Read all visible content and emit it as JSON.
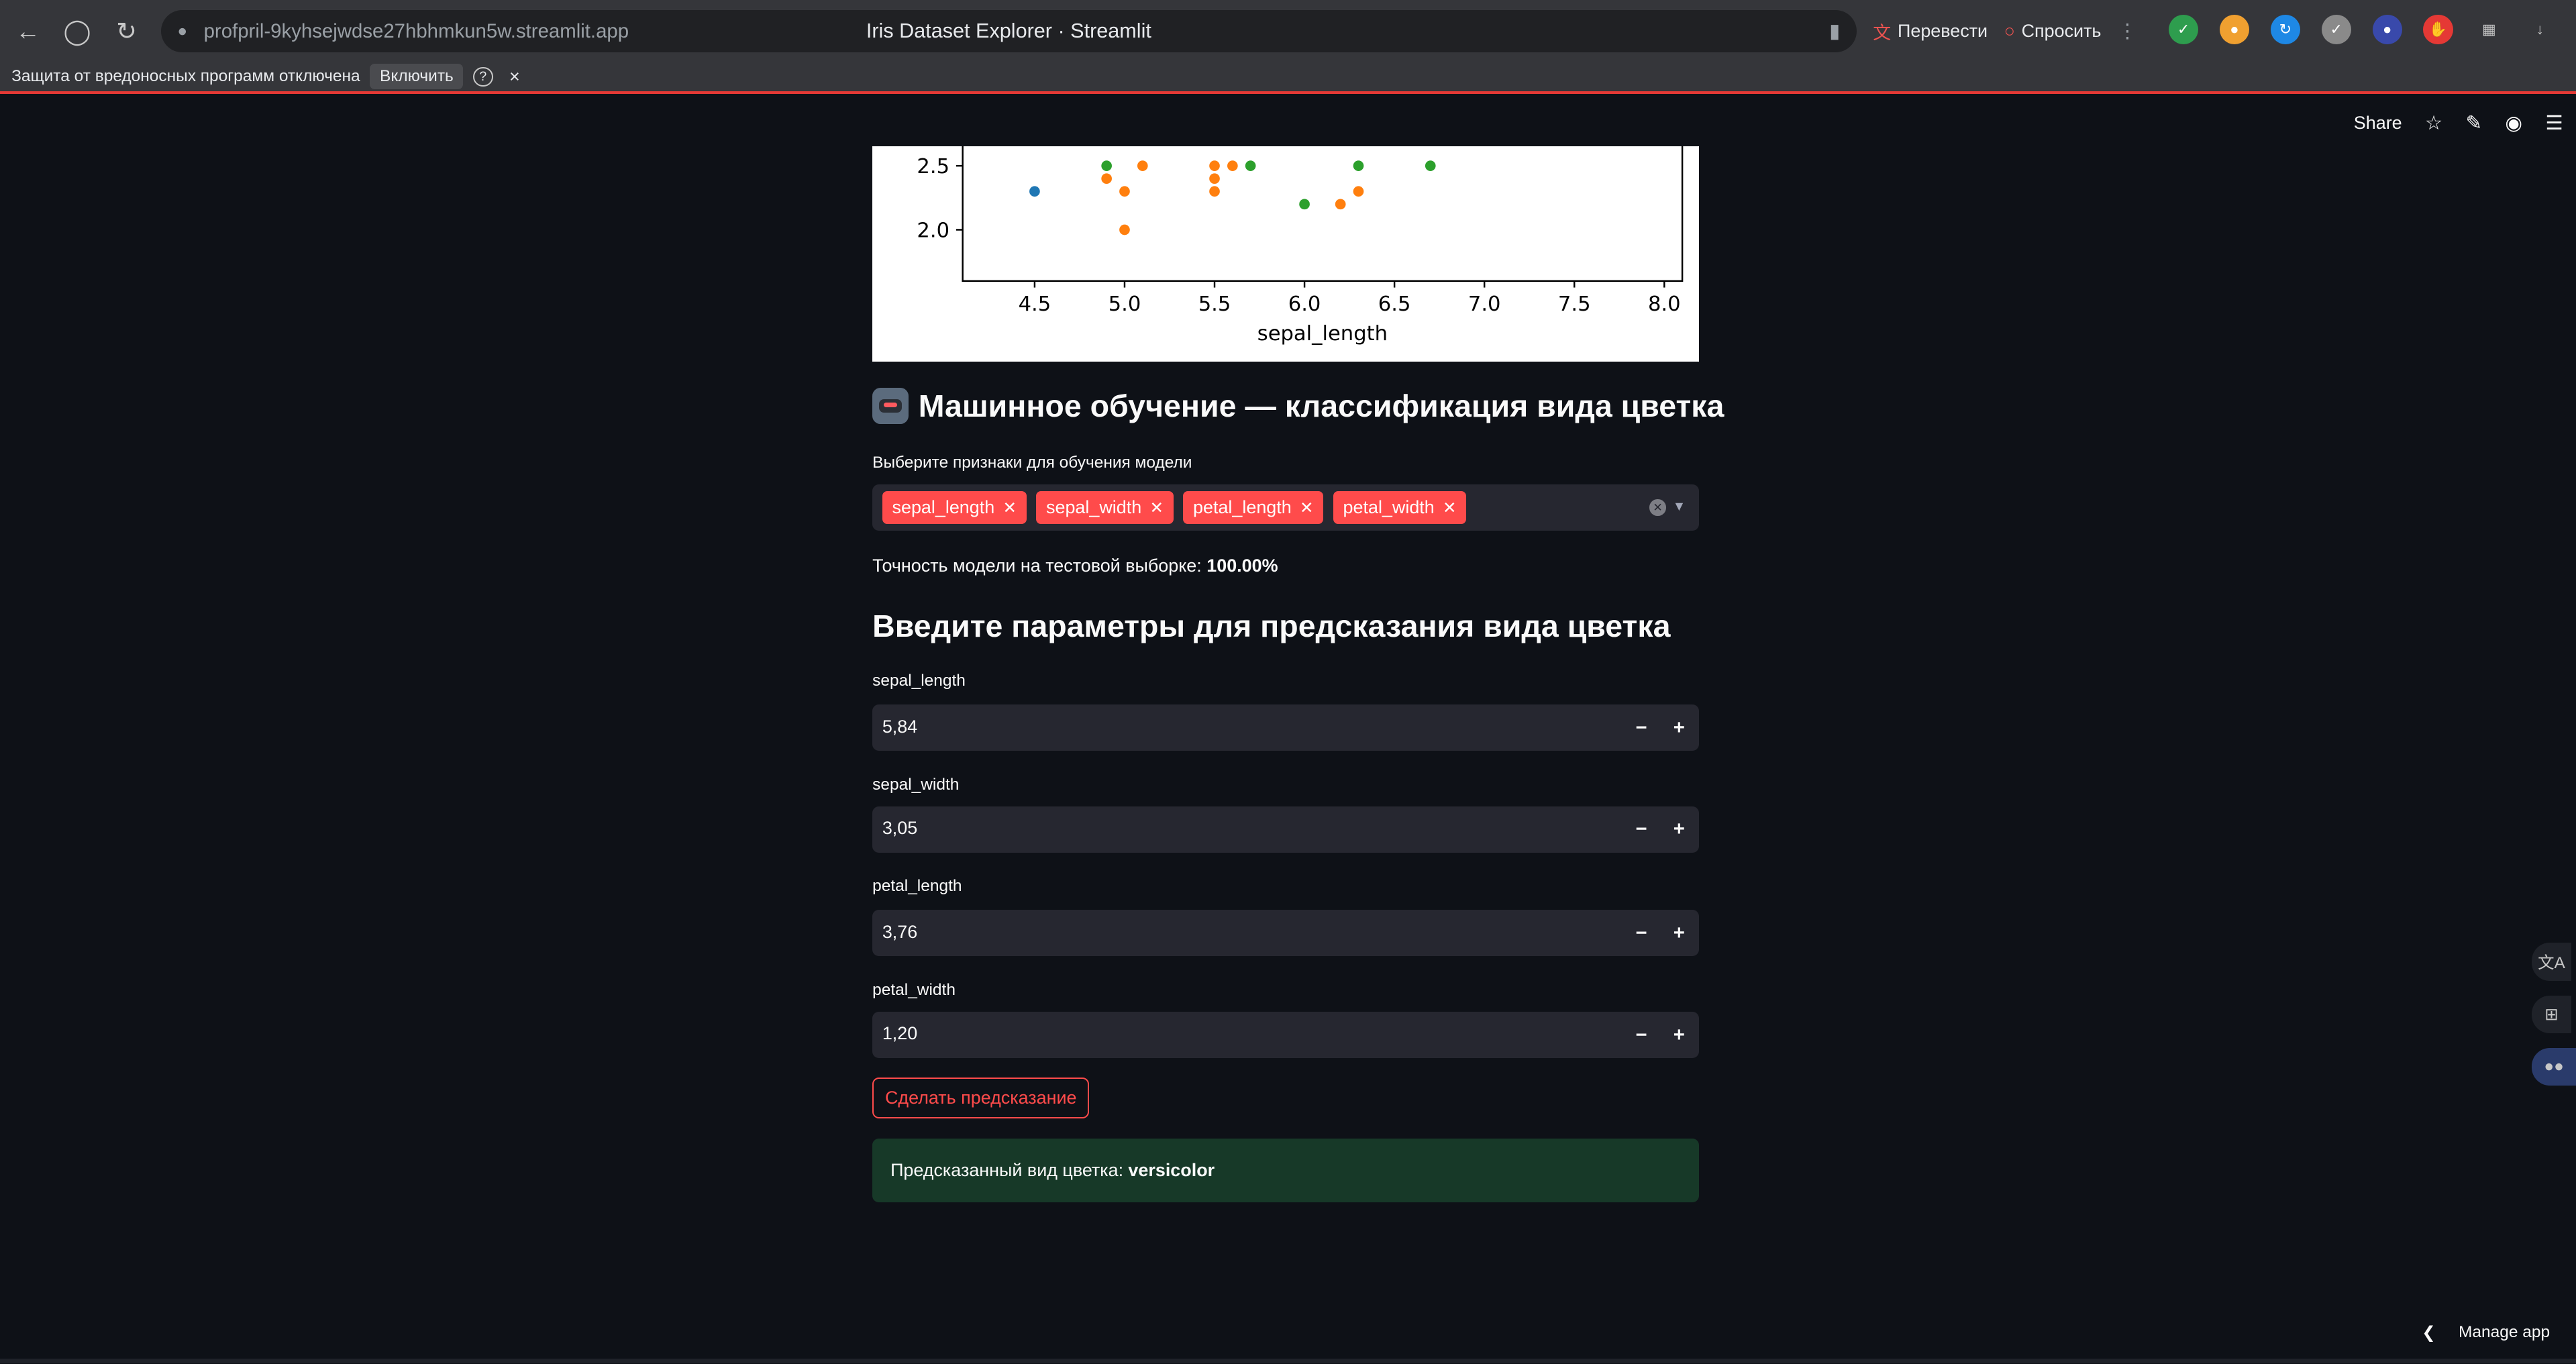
{
  "browser": {
    "url": "profpril-9kyhsejwdse27hbhmkun5w.streamlit.app",
    "tab_title": "Iris Dataset Explorer · Streamlit",
    "translate_label": "Перевести",
    "ask_label": "Спросить",
    "icons": [
      "back-icon",
      "yandex-icon",
      "reload-icon",
      "lock-icon",
      "bookmark-icon"
    ]
  },
  "infobar": {
    "message": "Защита от вредоносных программ отключена",
    "enable_label": "Включить",
    "help": "?",
    "close": "×"
  },
  "header": {
    "share_label": "Share"
  },
  "chart_data": {
    "type": "scatter",
    "xlabel": "sepal_length",
    "xlim": [
      4.1,
      8.1
    ],
    "ylim": [
      1.6,
      2.55
    ],
    "x_ticks": [
      4.5,
      5.0,
      5.5,
      6.0,
      6.5,
      7.0,
      7.5,
      8.0
    ],
    "x_tick_labels": [
      "4.5",
      "5.0",
      "5.5",
      "6.0",
      "6.5",
      "7.0",
      "7.5",
      "8.0"
    ],
    "y_ticks": [
      2.0,
      2.5
    ],
    "y_tick_labels": [
      "2.0",
      "2.5"
    ],
    "series": [
      {
        "color": "#1f77b4",
        "points": [
          [
            4.5,
            2.3
          ]
        ]
      },
      {
        "color": "#ff7f0e",
        "points": [
          [
            4.9,
            2.4
          ],
          [
            5.0,
            2.3
          ],
          [
            5.0,
            2.0
          ],
          [
            5.1,
            2.5
          ],
          [
            5.5,
            2.5
          ],
          [
            5.5,
            2.4
          ],
          [
            5.5,
            2.3
          ],
          [
            5.6,
            2.5
          ],
          [
            6.2,
            2.2
          ],
          [
            6.3,
            2.3
          ]
        ]
      },
      {
        "color": "#2ca02c",
        "points": [
          [
            4.9,
            2.5
          ],
          [
            5.7,
            2.5
          ],
          [
            6.0,
            2.2
          ],
          [
            6.3,
            2.5
          ],
          [
            6.7,
            2.5
          ]
        ]
      }
    ]
  },
  "ml": {
    "title": "Машинное обучение — классификация вида цветка",
    "features_label": "Выберите признаки для обучения модели",
    "features": [
      "sepal_length",
      "sepal_width",
      "petal_length",
      "petal_width"
    ],
    "accuracy_label": "Точность модели на тестовой выборке:",
    "accuracy_value": "100.00%"
  },
  "predict": {
    "title": "Введите параметры для предсказания вида цветка",
    "inputs": [
      {
        "label": "sepal_length",
        "value": "5,84"
      },
      {
        "label": "sepal_width",
        "value": "3,05"
      },
      {
        "label": "petal_length",
        "value": "3,76"
      },
      {
        "label": "petal_width",
        "value": "1,20"
      }
    ],
    "button_label": "Сделать предсказание",
    "result_label": "Предсказанный вид цветка:",
    "result_value": "versicolor"
  },
  "footer": {
    "manage_label": "Manage app"
  }
}
